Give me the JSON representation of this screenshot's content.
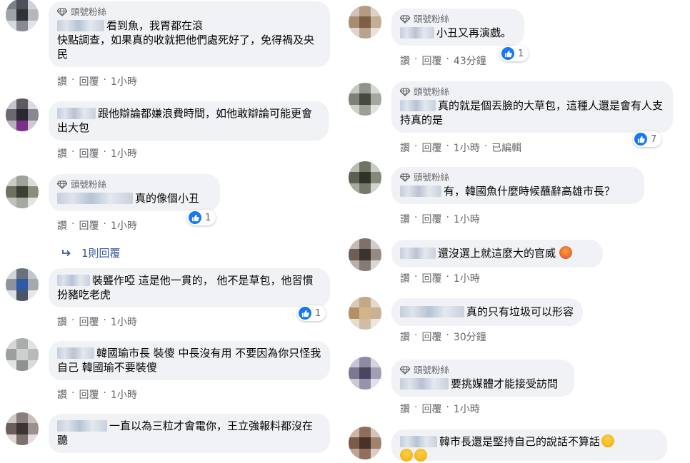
{
  "badge_label": "頭號粉絲",
  "left_comments": [
    {
      "text": "看到魚，我胃都在滾\n快點調查，如果真的收就把他們處死好了，免得禍及央民",
      "actions": [
        "讚",
        "回覆",
        "1小時"
      ]
    },
    {
      "text": "跟他辯論都嫌浪費時間，如他敢辯論可能更會出大包",
      "actions": [
        "讚",
        "回覆",
        "1小時"
      ]
    },
    {
      "text": "真的像個小丑",
      "actions": [
        "讚",
        "回覆",
        "1小時"
      ],
      "likes": "1"
    },
    {
      "text": "裝聾作啞 這是他一貫的， 他不是草包，他習慣扮豬吃老虎",
      "actions": [
        "讚",
        "回覆",
        "1小時"
      ],
      "likes": "1"
    },
    {
      "text": "韓國瑜市長 裝傻 中長沒有用 不要因為你只怪我自己 韓國瑜不要裝傻",
      "actions": [
        "讚",
        "回覆",
        "1小時"
      ]
    },
    {
      "text": "一直以為三粒才會電你，王立強報料都沒在聽"
    }
  ],
  "reply_link": "1則回覆",
  "right_comments": [
    {
      "text": "小丑又再演戲。",
      "actions": [
        "讚",
        "回覆",
        "43分鐘"
      ],
      "likes": "1"
    },
    {
      "text": "真的就是個丟臉的大草包，這種人還是會有人支持真的是",
      "actions": [
        "讚",
        "回覆",
        "1小時",
        "已編輯"
      ],
      "likes": "7"
    },
    {
      "text": "有，韓國魚什麼時候蘸辭高雄市長？",
      "actions": [
        "讚",
        "回覆",
        "1小時"
      ]
    },
    {
      "text": "還沒選上就這麼大的官威",
      "actions": [
        "讚",
        "回覆",
        "1小時"
      ]
    },
    {
      "text": "真的只有垃圾可以形容",
      "actions": [
        "讚",
        "回覆",
        "30分鐘"
      ]
    },
    {
      "text": "要挑媒體才能接受訪問",
      "actions": [
        "讚",
        "回覆",
        "1小時"
      ]
    },
    {
      "text": "韓市長還是堅持自己的說話不算話"
    }
  ],
  "colors": {
    "bubble": "#f0f2f5",
    "meta": "#65676b",
    "link": "#385898",
    "like": "#1877f2"
  }
}
